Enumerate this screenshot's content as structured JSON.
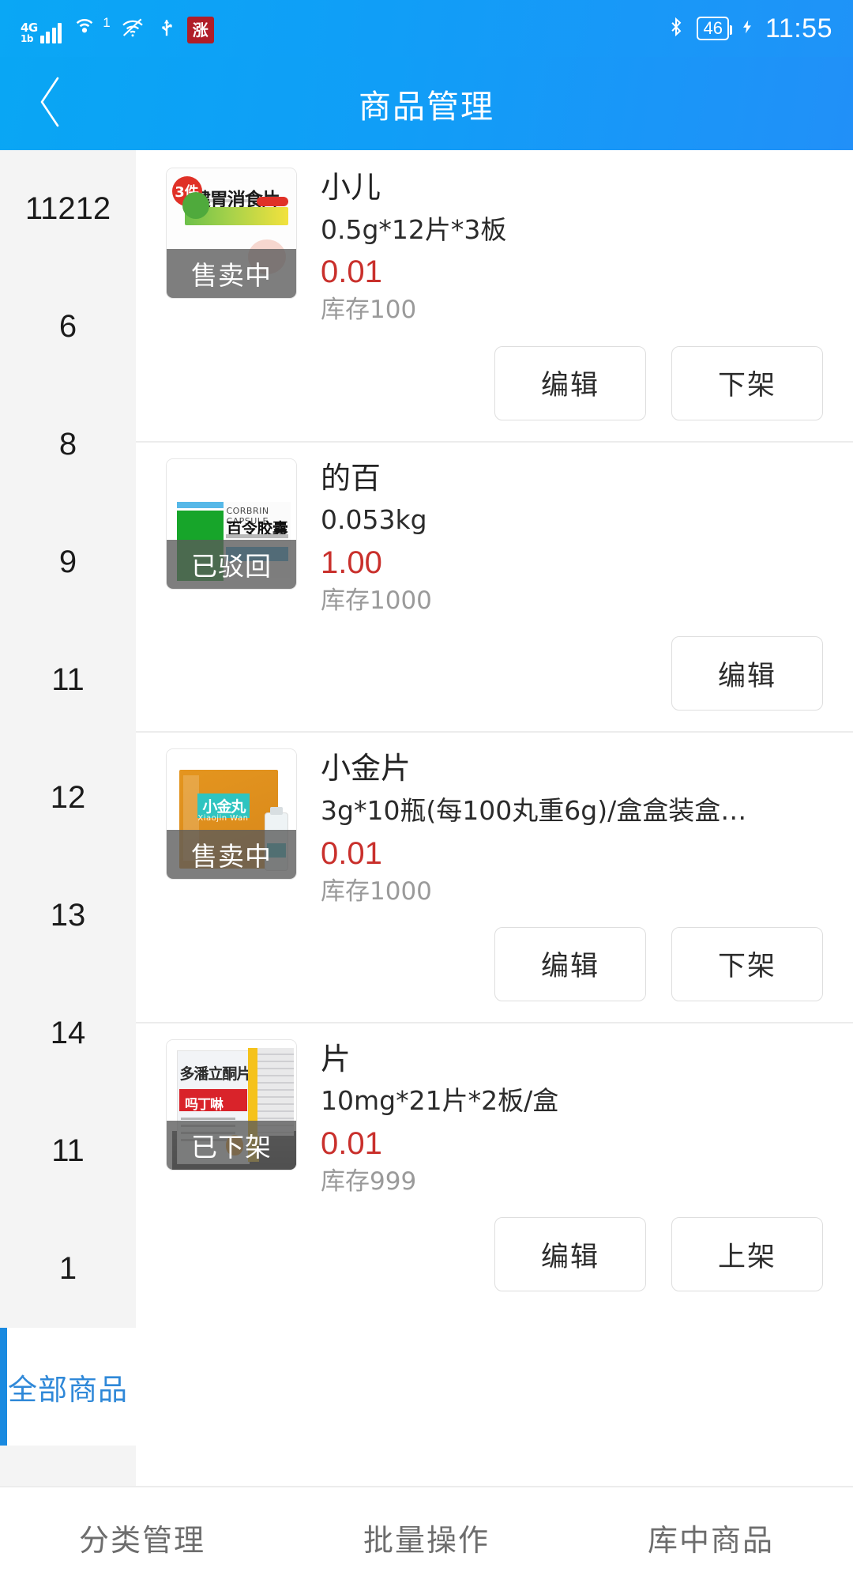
{
  "status_bar": {
    "network_type": "4G",
    "network_sub": "1b",
    "hotspot_badge": "1",
    "icons": [
      "signal-bars-icon",
      "hotspot-icon",
      "wifi-off-icon",
      "usb-icon",
      "app-icon"
    ],
    "app_badge_text": "涨",
    "bluetooth": "bluetooth-icon",
    "battery_level": "46",
    "charging": "charging-bolt-icon",
    "time": "11:55"
  },
  "header": {
    "title": "商品管理",
    "back_icon": "back-chevron-icon",
    "bg_color": "#0f9ff7"
  },
  "sidebar": {
    "categories": [
      {
        "label": "11212",
        "selected": false
      },
      {
        "label": "6",
        "selected": false
      },
      {
        "label": "8",
        "selected": false
      },
      {
        "label": "9",
        "selected": false
      },
      {
        "label": "11",
        "selected": false
      },
      {
        "label": "12",
        "selected": false
      },
      {
        "label": "13",
        "selected": false
      },
      {
        "label": "14",
        "selected": false
      },
      {
        "label": "11",
        "selected": false
      },
      {
        "label": "1",
        "selected": false
      },
      {
        "label": "全部商品",
        "selected": true
      }
    ],
    "selected_color": "#2f88d8"
  },
  "products": [
    {
      "name": "小儿",
      "spec": "0.5g*12片*3板",
      "price": "0.01",
      "stock": "库存100",
      "status_badge": "售卖中",
      "thumb_name": "健胃消食片",
      "thumb_sub": "3件",
      "actions": [
        "编辑",
        "下架"
      ]
    },
    {
      "name": "的百",
      "spec": "0.053kg",
      "price": "1.00",
      "stock": "库存1000",
      "status_badge": "已驳回",
      "thumb_name": "百令胶囊",
      "thumb_sub": "CORBRIN CAPSULE",
      "actions": [
        "编辑"
      ]
    },
    {
      "name": "小金片",
      "spec": " 3g*10瓶(每100丸重6g)/盒盒装盒…",
      "price": "0.01",
      "stock": "库存1000",
      "status_badge": "售卖中",
      "thumb_name": "小金丸",
      "thumb_sub": "Xiaojin Wan",
      "actions": [
        "编辑",
        "下架"
      ]
    },
    {
      "name": "片",
      "spec": "10mg*21片*2板/盒",
      "price": "0.01",
      "stock": "库存999",
      "status_badge": "已下架",
      "thumb_name": "多潘立酮片",
      "thumb_sub": "吗丁啉",
      "actions": [
        "编辑",
        "上架"
      ]
    }
  ],
  "bottom_bar": {
    "items": [
      "分类管理",
      "批量操作",
      "库中商品"
    ]
  },
  "colors": {
    "price_red": "#c9302c",
    "accent_blue": "#1a8ae0",
    "stock_gray": "#9a9a9a"
  }
}
